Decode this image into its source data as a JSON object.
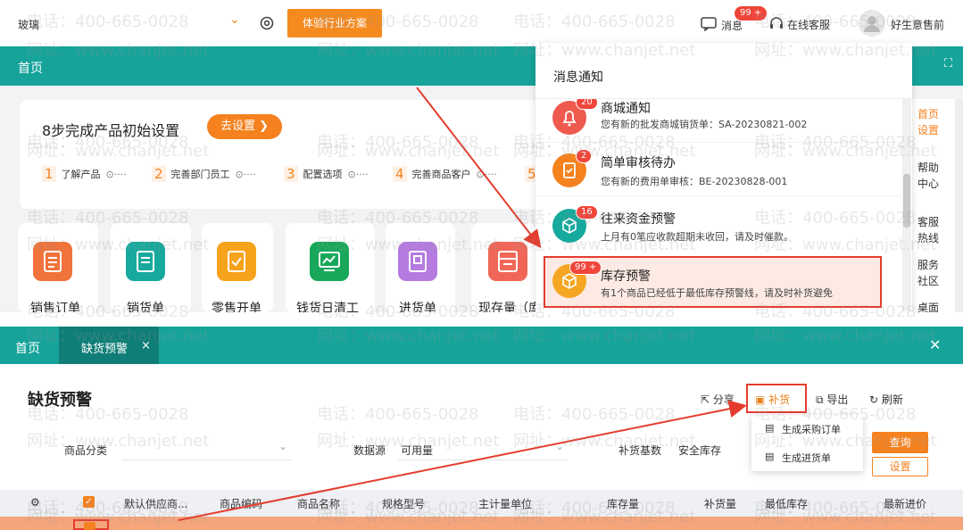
{
  "header": {
    "company": "玻璃",
    "trial_button": "体验行业方案",
    "messages_label": "消息",
    "messages_badge": "99 +",
    "support_label": "在线客服",
    "user_name": "好生意售前"
  },
  "main_tab": "首页",
  "setup": {
    "title": "8步完成产品初始设置",
    "button": "去设置 ❯",
    "steps": [
      {
        "num": "1",
        "label": "了解产品"
      },
      {
        "num": "2",
        "label": "完善部门员工"
      },
      {
        "num": "3",
        "label": "配置选项"
      },
      {
        "num": "4",
        "label": "完善商品客户"
      },
      {
        "num": "5",
        "label": ""
      }
    ]
  },
  "apps": [
    {
      "label": "销售订单",
      "color": "#f0733b"
    },
    {
      "label": "销货单",
      "color": "#17a99d"
    },
    {
      "label": "零售开单",
      "color": "#f7a21b"
    },
    {
      "label": "钱货日清工",
      "color": "#19a85b"
    },
    {
      "label": "进货单",
      "color": "#b57be0"
    },
    {
      "label": "现存量（库",
      "color": "#f06757"
    }
  ],
  "notifications": {
    "title": "消息通知",
    "items": [
      {
        "title": "商城通知",
        "desc": "您有新的批发商城销货单：SA-20230821-002",
        "badge": "20",
        "color": "#ef5a4f",
        "icon": "bell"
      },
      {
        "title": "简单审核待办",
        "desc": "您有新的费用单审核：BE-20230828-001",
        "badge": "2",
        "color": "#f5821f",
        "icon": "clipboard"
      },
      {
        "title": "往来资金预警",
        "desc": "上月有0笔应收款超期未收回，请及时催款。",
        "badge": "16",
        "color": "#17a99d",
        "icon": "cube"
      },
      {
        "title": "库存预警",
        "desc": "有1个商品已经低于最低库存预警线，请及时补货避免",
        "badge": "99 +",
        "color": "#f5a623",
        "icon": "box"
      }
    ]
  },
  "right_sidebar": [
    "首页",
    "设置",
    "帮助",
    "中心",
    "客服",
    "热线",
    "服务",
    "社区",
    "桌面"
  ],
  "bottom_tabs": {
    "home": "首页",
    "active": "缺货预警"
  },
  "page_title": "缺货预警",
  "toolbar": {
    "share": "分享",
    "replenish": "补货",
    "export": "导出",
    "refresh": "刷新"
  },
  "replenish_menu": [
    "生成采购订单",
    "生成进货单"
  ],
  "filters": {
    "category_label": "商品分类",
    "source_label": "数据源",
    "source_value": "可用量",
    "basis_label": "补货基数",
    "basis_value": "安全库存",
    "query_button": "查询",
    "settings_button": "设置"
  },
  "table": {
    "columns": [
      "默认供应商...",
      "商品编码",
      "商品名称",
      "规格型号",
      "主计量单位",
      "库存量",
      "补货量",
      "最低库存",
      "最新进价"
    ]
  },
  "watermark": {
    "phone": "电话：400-665-0028",
    "site": "网址：www.chanjet.net"
  }
}
